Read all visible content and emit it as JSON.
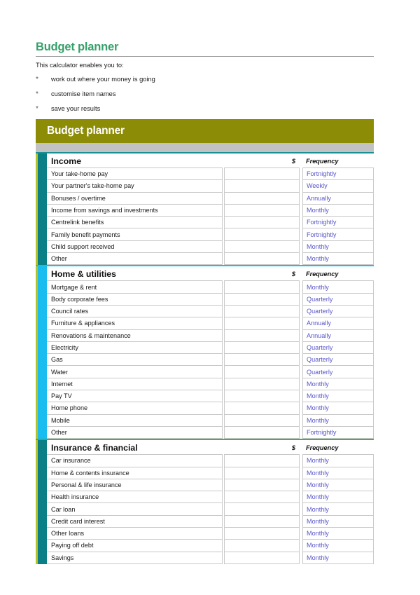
{
  "intro": {
    "title": "Budget planner",
    "lead": "This calculator enables you to:",
    "bullet_mark": "*",
    "bullets": [
      "work out where your money is going",
      "customise item names",
      "save your results"
    ]
  },
  "banner": {
    "title": "Budget planner",
    "background_color": "#8d8c06",
    "strip_color": "#c2c2c2"
  },
  "columns": {
    "amount_header": "$",
    "frequency_header": "Frequency"
  },
  "colors": {
    "title_green": "#35a06a",
    "accent_teal": "#0a8086",
    "accent_cyan": "#19bdf0",
    "divider_green": "#4fa860",
    "frequency_text": "#5a57c8",
    "edge_yellow_green": "#b5c32a"
  },
  "sections": [
    {
      "name": "Income",
      "accent": "teal",
      "divider": "teal",
      "rows": [
        {
          "label": "Your take-home pay",
          "amount": "",
          "frequency": "Fortnightly"
        },
        {
          "label": "Your partner's take-home pay",
          "amount": "",
          "frequency": "Weekly"
        },
        {
          "label": "Bonuses / overtime",
          "amount": "",
          "frequency": "Annually"
        },
        {
          "label": "Income from savings and investments",
          "amount": "",
          "frequency": "Monthly"
        },
        {
          "label": "Centrelink benefits",
          "amount": "",
          "frequency": "Fortnightly"
        },
        {
          "label": "Family benefit payments",
          "amount": "",
          "frequency": "Fortnightly"
        },
        {
          "label": "Child support received",
          "amount": "",
          "frequency": "Monthly"
        },
        {
          "label": "Other",
          "amount": "",
          "frequency": "Monthly"
        }
      ]
    },
    {
      "name": "Home & utilities",
      "accent": "cyan",
      "divider": "cyan",
      "rows": [
        {
          "label": "Mortgage & rent",
          "amount": "",
          "frequency": "Monthly"
        },
        {
          "label": "Body corporate fees",
          "amount": "",
          "frequency": "Quarterly"
        },
        {
          "label": "Council rates",
          "amount": "",
          "frequency": "Quarterly"
        },
        {
          "label": "Furniture & appliances",
          "amount": "",
          "frequency": "Annually"
        },
        {
          "label": "Renovations & maintenance",
          "amount": "",
          "frequency": "Annually"
        },
        {
          "label": "Electricity",
          "amount": "",
          "frequency": "Quarterly"
        },
        {
          "label": "Gas",
          "amount": "",
          "frequency": "Quarterly"
        },
        {
          "label": "Water",
          "amount": "",
          "frequency": "Quarterly"
        },
        {
          "label": "Internet",
          "amount": "",
          "frequency": "Monthly"
        },
        {
          "label": "Pay TV",
          "amount": "",
          "frequency": "Monthly"
        },
        {
          "label": "Home phone",
          "amount": "",
          "frequency": "Monthly"
        },
        {
          "label": "Mobile",
          "amount": "",
          "frequency": "Monthly"
        },
        {
          "label": "Other",
          "amount": "",
          "frequency": "Fortnightly"
        }
      ]
    },
    {
      "name": "Insurance & financial",
      "accent": "teal",
      "divider": "green",
      "rows": [
        {
          "label": "Car insurance",
          "amount": "",
          "frequency": "Monthly"
        },
        {
          "label": "Home & contents insurance",
          "amount": "",
          "frequency": "Monthly"
        },
        {
          "label": "Personal & life insurance",
          "amount": "",
          "frequency": "Monthly"
        },
        {
          "label": "Health insurance",
          "amount": "",
          "frequency": "Monthly"
        },
        {
          "label": "Car loan",
          "amount": "",
          "frequency": "Monthly"
        },
        {
          "label": "Credit card interest",
          "amount": "",
          "frequency": "Monthly"
        },
        {
          "label": "Other loans",
          "amount": "",
          "frequency": "Monthly"
        },
        {
          "label": "Paying off debt",
          "amount": "",
          "frequency": "Monthly"
        },
        {
          "label": "Savings",
          "amount": "",
          "frequency": "Monthly"
        }
      ]
    }
  ]
}
